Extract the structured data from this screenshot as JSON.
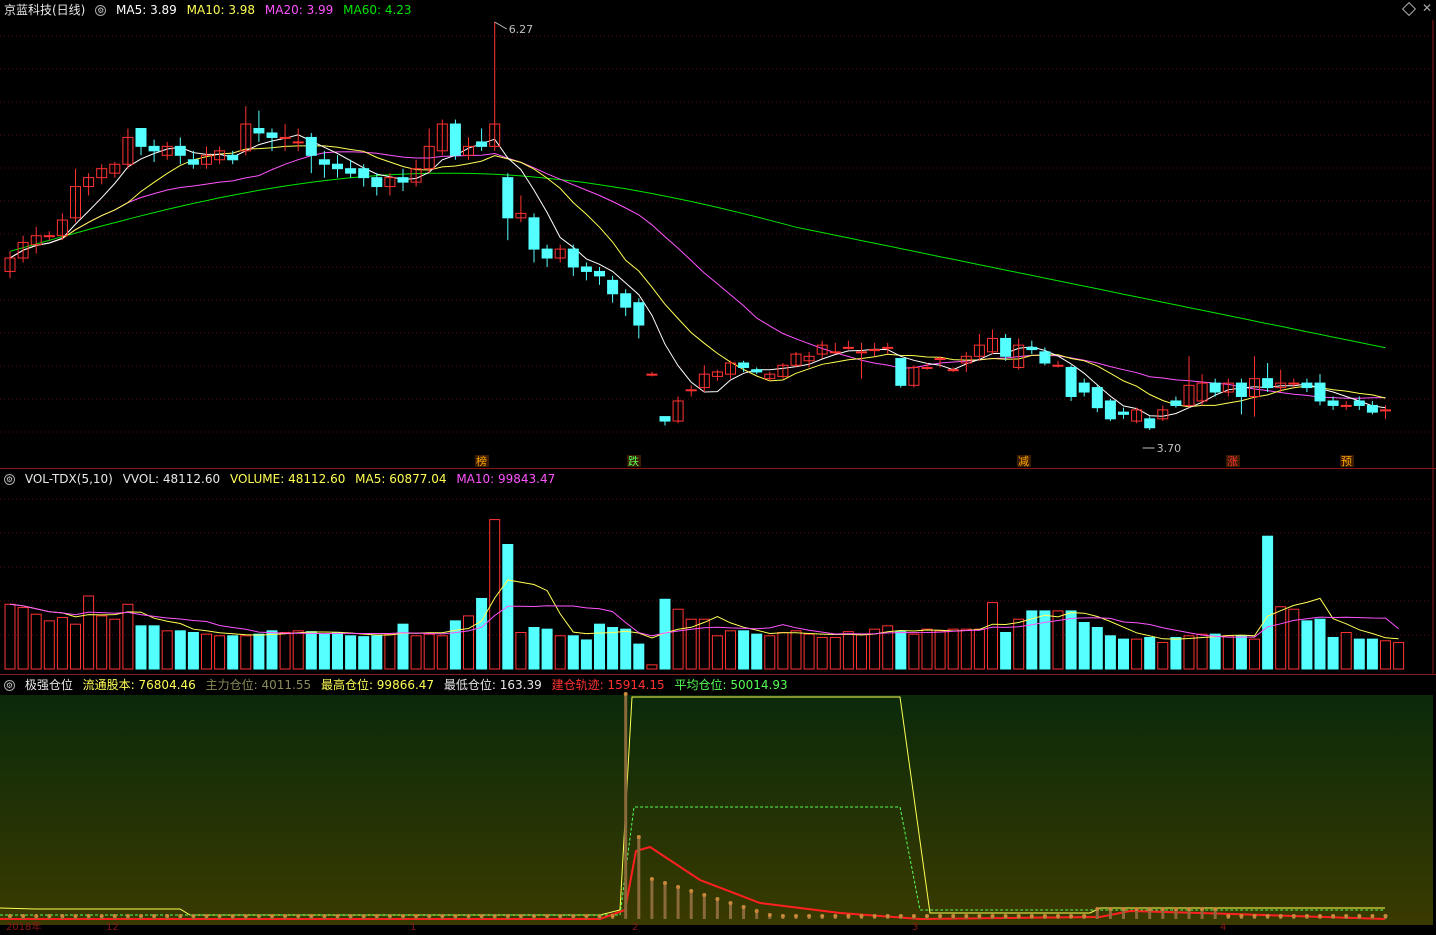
{
  "main": {
    "title": "京蓝科技(日线)",
    "ma5": "MA5: 3.89",
    "ma10": "MA10: 3.98",
    "ma20": "MA20: 3.99",
    "ma60": "MA60: 4.23",
    "high_label": "6.27",
    "low_label": "3.70",
    "markers": [
      "榜",
      "跌",
      "减",
      "涨",
      "预"
    ],
    "colors": {
      "up": "#ff3232",
      "down": "#54ffff",
      "ma5": "#ffffff",
      "ma10": "#ffff54",
      "ma20": "#ff54ff",
      "ma60": "#00e600"
    }
  },
  "volume": {
    "title": "VOL-TDX(5,10)",
    "vvol": "VVOL: 48112.60",
    "volume": "VOLUME: 48112.60",
    "ma5": "MA5: 60877.04",
    "ma10": "MA10: 99843.47"
  },
  "indicator": {
    "title": "极强仓位",
    "float_shares": "流通股本: 76804.46",
    "main_pos": "主力仓位: 4011.55",
    "max_pos": "最高仓位: 99866.47",
    "min_pos": "最低仓位: 163.39",
    "build_track": "建仓轨迹: 15914.15",
    "avg_pos": "平均仓位: 50014.93"
  },
  "xaxis": {
    "labels": [
      "2018年",
      "12",
      "1",
      "2",
      "3",
      "4"
    ]
  },
  "candles": [
    [
      3.96,
      4.02,
      3.93,
      4.05
    ],
    [
      4.02,
      4.09,
      4.0,
      4.12
    ],
    [
      4.08,
      4.12,
      4.04,
      4.16
    ],
    [
      4.12,
      4.12,
      4.1,
      4.14
    ],
    [
      4.12,
      4.19,
      4.1,
      4.22
    ],
    [
      4.2,
      4.34,
      4.18,
      4.42
    ],
    [
      4.34,
      4.38,
      4.3,
      4.4
    ],
    [
      4.38,
      4.42,
      4.35,
      4.44
    ],
    [
      4.4,
      4.44,
      4.38,
      4.45
    ],
    [
      4.44,
      4.56,
      4.42,
      4.6
    ],
    [
      4.6,
      4.52,
      4.48,
      4.6
    ],
    [
      4.52,
      4.5,
      4.45,
      4.55
    ],
    [
      4.48,
      4.52,
      4.46,
      4.54
    ],
    [
      4.52,
      4.48,
      4.44,
      4.56
    ],
    [
      4.46,
      4.44,
      4.42,
      4.5
    ],
    [
      4.44,
      4.48,
      4.42,
      4.52
    ],
    [
      4.46,
      4.5,
      4.44,
      4.52
    ],
    [
      4.48,
      4.46,
      4.44,
      4.5
    ],
    [
      4.5,
      4.62,
      4.48,
      4.7
    ],
    [
      4.6,
      4.58,
      4.54,
      4.68
    ],
    [
      4.58,
      4.56,
      4.5,
      4.6
    ],
    [
      4.56,
      4.56,
      4.5,
      4.62
    ],
    [
      4.54,
      4.54,
      4.5,
      4.6
    ],
    [
      4.56,
      4.48,
      4.4,
      4.58
    ],
    [
      4.46,
      4.44,
      4.38,
      4.5
    ],
    [
      4.44,
      4.42,
      4.38,
      4.48
    ],
    [
      4.42,
      4.4,
      4.38,
      4.46
    ],
    [
      4.42,
      4.38,
      4.34,
      4.44
    ],
    [
      4.38,
      4.34,
      4.3,
      4.4
    ],
    [
      4.34,
      4.38,
      4.3,
      4.4
    ],
    [
      4.38,
      4.36,
      4.32,
      4.42
    ],
    [
      4.36,
      4.42,
      4.34,
      4.46
    ],
    [
      4.42,
      4.52,
      4.4,
      4.6
    ],
    [
      4.5,
      4.62,
      4.48,
      4.64
    ],
    [
      4.62,
      4.48,
      4.46,
      4.64
    ],
    [
      4.48,
      4.52,
      4.46,
      4.56
    ],
    [
      4.54,
      4.52,
      4.5,
      4.6
    ],
    [
      4.52,
      4.62,
      4.5,
      6.27
    ],
    [
      4.38,
      4.2,
      4.1,
      4.4
    ],
    [
      4.2,
      4.22,
      4.18,
      4.3
    ],
    [
      4.2,
      4.06,
      4.0,
      4.22
    ],
    [
      4.06,
      4.02,
      3.98,
      4.08
    ],
    [
      4.02,
      4.06,
      4.0,
      4.08
    ],
    [
      4.06,
      3.98,
      3.94,
      4.08
    ],
    [
      3.98,
      3.96,
      3.92,
      4.0
    ],
    [
      3.96,
      3.94,
      3.9,
      3.98
    ],
    [
      3.92,
      3.86,
      3.82,
      3.94
    ],
    [
      3.86,
      3.8,
      3.76,
      3.88
    ],
    [
      3.82,
      3.72,
      3.66,
      3.84
    ],
    [
      3.5,
      3.5,
      3.49,
      3.51
    ],
    [
      3.31,
      3.29,
      3.27,
      3.31
    ],
    [
      3.29,
      3.38,
      3.28,
      3.4
    ],
    [
      3.43,
      3.43,
      3.4,
      3.45
    ],
    [
      3.44,
      3.5,
      3.42,
      3.54
    ],
    [
      3.49,
      3.51,
      3.47,
      3.52
    ],
    [
      3.5,
      3.55,
      3.48,
      3.56
    ],
    [
      3.55,
      3.53,
      3.51,
      3.56
    ],
    [
      3.52,
      3.51,
      3.5,
      3.53
    ],
    [
      3.48,
      3.5,
      3.47,
      3.51
    ],
    [
      3.49,
      3.54,
      3.48,
      3.55
    ],
    [
      3.54,
      3.59,
      3.53,
      3.6
    ],
    [
      3.56,
      3.58,
      3.53,
      3.6
    ],
    [
      3.59,
      3.63,
      3.57,
      3.65
    ],
    [
      3.6,
      3.6,
      3.59,
      3.64
    ],
    [
      3.62,
      3.62,
      3.61,
      3.65
    ],
    [
      3.6,
      3.6,
      3.48,
      3.64
    ],
    [
      3.61,
      3.61,
      3.58,
      3.64
    ],
    [
      3.62,
      3.62,
      3.59,
      3.64
    ],
    [
      3.57,
      3.45,
      3.44,
      3.57
    ],
    [
      3.45,
      3.53,
      3.44,
      3.54
    ],
    [
      3.53,
      3.53,
      3.52,
      3.55
    ],
    [
      3.57,
      3.57,
      3.53,
      3.58
    ],
    [
      3.52,
      3.52,
      3.51,
      3.53
    ],
    [
      3.55,
      3.58,
      3.51,
      3.6
    ],
    [
      3.58,
      3.63,
      3.56,
      3.68
    ],
    [
      3.6,
      3.66,
      3.59,
      3.7
    ],
    [
      3.66,
      3.58,
      3.56,
      3.68
    ],
    [
      3.53,
      3.63,
      3.52,
      3.66
    ],
    [
      3.62,
      3.61,
      3.59,
      3.65
    ],
    [
      3.6,
      3.55,
      3.54,
      3.62
    ],
    [
      3.54,
      3.54,
      3.53,
      3.56
    ],
    [
      3.53,
      3.4,
      3.38,
      3.54
    ],
    [
      3.46,
      3.42,
      3.4,
      3.48
    ],
    [
      3.44,
      3.35,
      3.33,
      3.45
    ],
    [
      3.38,
      3.3,
      3.29,
      3.39
    ],
    [
      3.33,
      3.32,
      3.3,
      3.35
    ],
    [
      3.29,
      3.34,
      3.28,
      3.35
    ],
    [
      3.3,
      3.26,
      3.25,
      3.31
    ],
    [
      3.3,
      3.34,
      3.29,
      3.36
    ],
    [
      3.38,
      3.36,
      3.35,
      3.4
    ],
    [
      3.36,
      3.45,
      3.35,
      3.58
    ],
    [
      3.38,
      3.46,
      3.36,
      3.5
    ],
    [
      3.46,
      3.42,
      3.4,
      3.48
    ],
    [
      3.42,
      3.46,
      3.4,
      3.48
    ],
    [
      3.46,
      3.4,
      3.32,
      3.48
    ],
    [
      3.4,
      3.48,
      3.31,
      3.58
    ],
    [
      3.48,
      3.44,
      3.42,
      3.55
    ],
    [
      3.44,
      3.46,
      3.42,
      3.52
    ],
    [
      3.46,
      3.46,
      3.44,
      3.48
    ],
    [
      3.46,
      3.44,
      3.42,
      3.48
    ],
    [
      3.46,
      3.38,
      3.36,
      3.5
    ],
    [
      3.38,
      3.36,
      3.34,
      3.4
    ],
    [
      3.36,
      3.36,
      3.34,
      3.38
    ],
    [
      3.38,
      3.36,
      3.34,
      3.4
    ],
    [
      3.36,
      3.33,
      3.32,
      3.38
    ],
    [
      3.34,
      3.34,
      3.3,
      3.36
    ]
  ],
  "volumes": [
    78,
    74,
    66,
    58,
    62,
    54,
    88,
    64,
    60,
    78,
    52,
    52,
    46,
    46,
    44,
    42,
    40,
    40,
    40,
    42,
    46,
    44,
    46,
    45,
    42,
    44,
    40,
    39,
    40,
    42,
    54,
    40,
    42,
    40,
    58,
    64,
    85,
    180,
    150,
    44,
    50,
    48,
    40,
    40,
    35,
    54,
    50,
    48,
    30,
    5,
    84,
    72,
    60,
    60,
    40,
    46,
    46,
    42,
    40,
    44,
    46,
    42,
    38,
    38,
    45,
    42,
    48,
    52,
    45,
    42,
    48,
    46,
    48,
    48,
    48,
    80,
    44,
    60,
    70,
    70,
    70,
    70,
    56,
    50,
    40,
    36,
    36,
    38,
    32,
    38,
    40,
    42,
    42,
    40,
    40,
    36,
    160,
    75,
    72,
    58,
    60,
    38,
    44,
    36,
    36,
    34,
    32
  ],
  "mamarkers_x": [
    482,
    634,
    1024,
    1233,
    1347
  ]
}
